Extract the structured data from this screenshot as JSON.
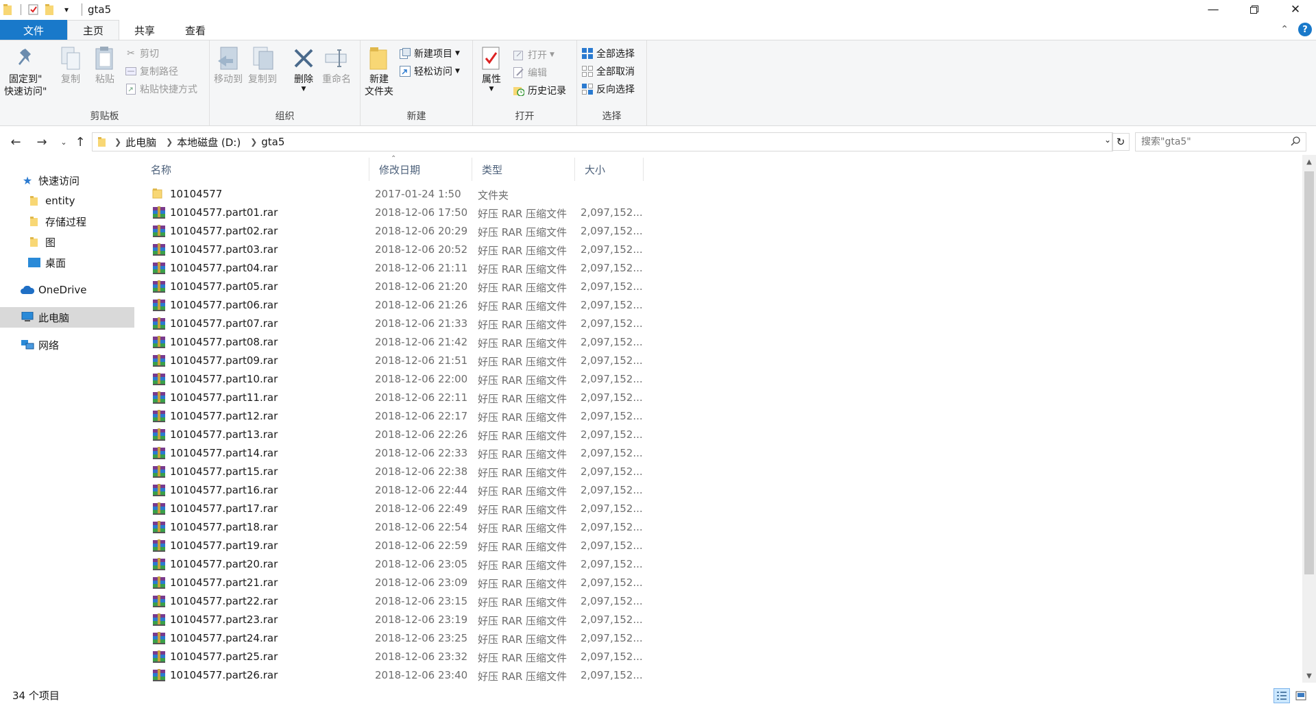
{
  "window": {
    "title": "gta5",
    "qat_dropdown": "▾"
  },
  "ribbon_tabs": [
    {
      "label": "文件"
    },
    {
      "label": "主页"
    },
    {
      "label": "共享"
    },
    {
      "label": "查看"
    }
  ],
  "ribbon": {
    "clipboard": {
      "label": "剪贴板",
      "pin_line1": "固定到\"",
      "pin_line2": "快速访问\"",
      "copy": "复制",
      "paste": "粘贴",
      "cut": "剪切",
      "copy_path": "复制路径",
      "paste_shortcut": "粘贴快捷方式"
    },
    "organize": {
      "label": "组织",
      "move_to": "移动到",
      "copy_to": "复制到",
      "delete": "删除",
      "rename": "重命名"
    },
    "new": {
      "label": "新建",
      "new_folder_line1": "新建",
      "new_folder_line2": "文件夹",
      "new_item": "新建项目",
      "easy_access": "轻松访问"
    },
    "open": {
      "label": "打开",
      "properties": "属性",
      "open": "打开",
      "edit": "编辑",
      "history": "历史记录"
    },
    "select": {
      "label": "选择",
      "select_all": "全部选择",
      "select_none": "全部取消",
      "invert": "反向选择"
    }
  },
  "address": {
    "crumbs": [
      "此电脑",
      "本地磁盘 (D:)",
      "gta5"
    ],
    "search_placeholder": "搜索\"gta5\""
  },
  "nav_pane": {
    "quick_access": "快速访问",
    "entity": "entity",
    "stored_proc": "存储过程",
    "pictures": "图",
    "desktop": "桌面",
    "onedrive": "OneDrive",
    "this_pc": "此电脑",
    "network": "网络"
  },
  "columns": {
    "name": "名称",
    "date": "修改日期",
    "type": "类型",
    "size": "大小"
  },
  "files": [
    {
      "name": "10104577",
      "date": "2017-01-24 1:50",
      "type": "文件夹",
      "size": "",
      "kind": "folder"
    },
    {
      "name": "10104577.part01.rar",
      "date": "2018-12-06 17:50",
      "type": "好压 RAR 压缩文件",
      "size": "2,097,152...",
      "kind": "rar"
    },
    {
      "name": "10104577.part02.rar",
      "date": "2018-12-06 20:29",
      "type": "好压 RAR 压缩文件",
      "size": "2,097,152...",
      "kind": "rar"
    },
    {
      "name": "10104577.part03.rar",
      "date": "2018-12-06 20:52",
      "type": "好压 RAR 压缩文件",
      "size": "2,097,152...",
      "kind": "rar"
    },
    {
      "name": "10104577.part04.rar",
      "date": "2018-12-06 21:11",
      "type": "好压 RAR 压缩文件",
      "size": "2,097,152...",
      "kind": "rar"
    },
    {
      "name": "10104577.part05.rar",
      "date": "2018-12-06 21:20",
      "type": "好压 RAR 压缩文件",
      "size": "2,097,152...",
      "kind": "rar"
    },
    {
      "name": "10104577.part06.rar",
      "date": "2018-12-06 21:26",
      "type": "好压 RAR 压缩文件",
      "size": "2,097,152...",
      "kind": "rar"
    },
    {
      "name": "10104577.part07.rar",
      "date": "2018-12-06 21:33",
      "type": "好压 RAR 压缩文件",
      "size": "2,097,152...",
      "kind": "rar"
    },
    {
      "name": "10104577.part08.rar",
      "date": "2018-12-06 21:42",
      "type": "好压 RAR 压缩文件",
      "size": "2,097,152...",
      "kind": "rar"
    },
    {
      "name": "10104577.part09.rar",
      "date": "2018-12-06 21:51",
      "type": "好压 RAR 压缩文件",
      "size": "2,097,152...",
      "kind": "rar"
    },
    {
      "name": "10104577.part10.rar",
      "date": "2018-12-06 22:00",
      "type": "好压 RAR 压缩文件",
      "size": "2,097,152...",
      "kind": "rar"
    },
    {
      "name": "10104577.part11.rar",
      "date": "2018-12-06 22:11",
      "type": "好压 RAR 压缩文件",
      "size": "2,097,152...",
      "kind": "rar"
    },
    {
      "name": "10104577.part12.rar",
      "date": "2018-12-06 22:17",
      "type": "好压 RAR 压缩文件",
      "size": "2,097,152...",
      "kind": "rar"
    },
    {
      "name": "10104577.part13.rar",
      "date": "2018-12-06 22:26",
      "type": "好压 RAR 压缩文件",
      "size": "2,097,152...",
      "kind": "rar"
    },
    {
      "name": "10104577.part14.rar",
      "date": "2018-12-06 22:33",
      "type": "好压 RAR 压缩文件",
      "size": "2,097,152...",
      "kind": "rar"
    },
    {
      "name": "10104577.part15.rar",
      "date": "2018-12-06 22:38",
      "type": "好压 RAR 压缩文件",
      "size": "2,097,152...",
      "kind": "rar"
    },
    {
      "name": "10104577.part16.rar",
      "date": "2018-12-06 22:44",
      "type": "好压 RAR 压缩文件",
      "size": "2,097,152...",
      "kind": "rar"
    },
    {
      "name": "10104577.part17.rar",
      "date": "2018-12-06 22:49",
      "type": "好压 RAR 压缩文件",
      "size": "2,097,152...",
      "kind": "rar"
    },
    {
      "name": "10104577.part18.rar",
      "date": "2018-12-06 22:54",
      "type": "好压 RAR 压缩文件",
      "size": "2,097,152...",
      "kind": "rar"
    },
    {
      "name": "10104577.part19.rar",
      "date": "2018-12-06 22:59",
      "type": "好压 RAR 压缩文件",
      "size": "2,097,152...",
      "kind": "rar"
    },
    {
      "name": "10104577.part20.rar",
      "date": "2018-12-06 23:05",
      "type": "好压 RAR 压缩文件",
      "size": "2,097,152...",
      "kind": "rar"
    },
    {
      "name": "10104577.part21.rar",
      "date": "2018-12-06 23:09",
      "type": "好压 RAR 压缩文件",
      "size": "2,097,152...",
      "kind": "rar"
    },
    {
      "name": "10104577.part22.rar",
      "date": "2018-12-06 23:15",
      "type": "好压 RAR 压缩文件",
      "size": "2,097,152...",
      "kind": "rar"
    },
    {
      "name": "10104577.part23.rar",
      "date": "2018-12-06 23:19",
      "type": "好压 RAR 压缩文件",
      "size": "2,097,152...",
      "kind": "rar"
    },
    {
      "name": "10104577.part24.rar",
      "date": "2018-12-06 23:25",
      "type": "好压 RAR 压缩文件",
      "size": "2,097,152...",
      "kind": "rar"
    },
    {
      "name": "10104577.part25.rar",
      "date": "2018-12-06 23:32",
      "type": "好压 RAR 压缩文件",
      "size": "2,097,152...",
      "kind": "rar"
    },
    {
      "name": "10104577.part26.rar",
      "date": "2018-12-06 23:40",
      "type": "好压 RAR 压缩文件",
      "size": "2,097,152...",
      "kind": "rar"
    }
  ],
  "status": {
    "item_count": "34 个项目"
  },
  "colors": {
    "file_tab": "#1979ca",
    "ribbon_bg": "#f5f6f7",
    "selected_nav": "#d9d9d9",
    "column_header_text": "#4c607a",
    "folder_yellow": "#f8d775"
  }
}
